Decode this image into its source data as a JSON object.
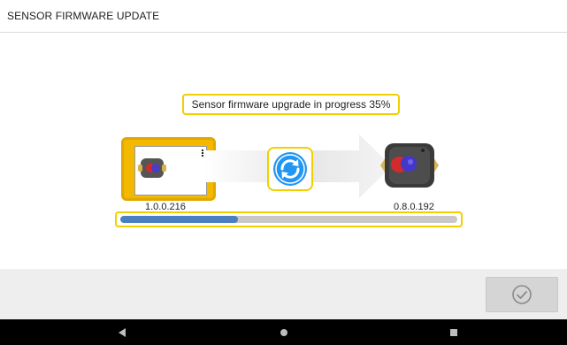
{
  "header": {
    "title": "SENSOR FIRMWARE UPDATE"
  },
  "status": {
    "message": "Sensor firmware upgrade in progress 35%"
  },
  "versions": {
    "device": "1.0.0.216",
    "sensor": "0.8.0.192"
  },
  "progress": {
    "fraction": 0.35
  },
  "icons": {
    "tablet": "tablet-device-icon",
    "arrow": "transfer-arrow-icon",
    "sync": "sync-icon",
    "sensor": "sensor-device-icon",
    "confirm": "checkmark-circle-icon",
    "nav_back": "back-triangle-icon",
    "nav_home": "home-circle-icon",
    "nav_recents": "recents-square-icon"
  },
  "colors": {
    "highlight": "#f2cf00",
    "progress_fill": "#4a7fc1",
    "sync_blue": "#2196f3",
    "tablet_yellow": "#f3b800"
  }
}
